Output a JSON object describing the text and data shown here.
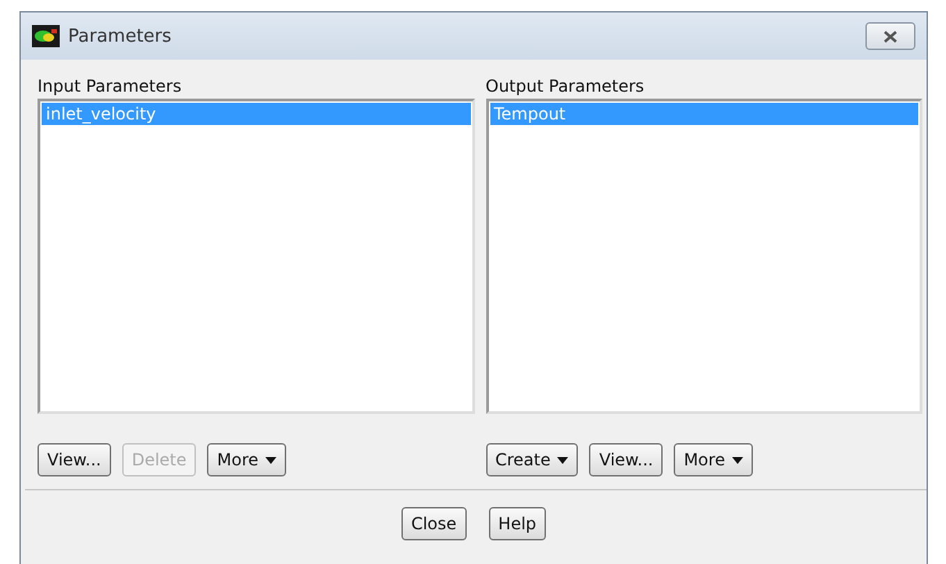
{
  "window": {
    "title": "Parameters"
  },
  "panels": [
    {
      "title": "Input Parameters",
      "items": [
        {
          "label": "inlet_velocity",
          "selected": true
        }
      ],
      "buttons": [
        {
          "label": "View...",
          "kind": "plain",
          "disabled": false
        },
        {
          "label": "Delete",
          "kind": "plain",
          "disabled": true
        },
        {
          "label": "More",
          "kind": "dropdown",
          "disabled": false
        }
      ]
    },
    {
      "title": "Output Parameters",
      "items": [
        {
          "label": "Tempout",
          "selected": true
        }
      ],
      "buttons": [
        {
          "label": "Create",
          "kind": "dropdown",
          "disabled": false
        },
        {
          "label": "View...",
          "kind": "plain",
          "disabled": false
        },
        {
          "label": "More",
          "kind": "dropdown",
          "disabled": false
        }
      ]
    }
  ],
  "footer_buttons": [
    "Close",
    "Help"
  ]
}
